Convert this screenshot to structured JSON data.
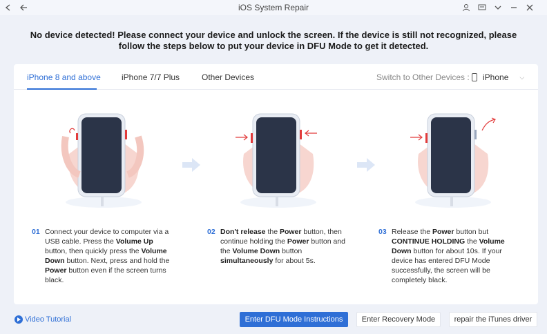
{
  "window": {
    "title": "iOS System Repair"
  },
  "headline": {
    "line1": "No device detected! Please connect your device and unlock the screen. If the device is still not recognized, please",
    "line2": "follow the steps below to put your device in DFU Mode to get it detected."
  },
  "tabs": [
    {
      "label": "iPhone 8 and above",
      "active": true
    },
    {
      "label": "iPhone 7/7 Plus",
      "active": false
    },
    {
      "label": "Other Devices",
      "active": false
    }
  ],
  "device_switch": {
    "label": "Switch to Other Devices :",
    "value": "iPhone"
  },
  "steps": [
    {
      "num": "01",
      "parts": [
        "Connect your device to computer via a USB cable. Press the ",
        "Volume Up",
        " button, then quickly press the ",
        "Volume Down",
        " button. Next, press and hold the ",
        "Power",
        " button even if the screen turns black."
      ]
    },
    {
      "num": "02",
      "parts": [
        "Don't release",
        " the ",
        "Power",
        " button, then continue holding the ",
        "Power",
        " button and the ",
        "Volume Down",
        " button ",
        "simultaneously",
        " for about 5s."
      ]
    },
    {
      "num": "03",
      "parts": [
        "Release the ",
        "Power",
        " button but ",
        "CONTINUE HOLDING",
        " the ",
        "Volume Down",
        " button for about 10s. If your device has entered DFU Mode successfully, the screen will be completely black."
      ]
    }
  ],
  "footer": {
    "video_tutorial": "Video Tutorial",
    "enter_dfu": "Enter DFU Mode Instructions",
    "enter_recovery": "Enter Recovery Mode",
    "repair_itunes": "repair the iTunes driver"
  },
  "colors": {
    "accent": "#2f6fd6",
    "background": "#eef1f8",
    "button_red": "#e23b3b"
  },
  "icons": [
    "back-arrow-icon",
    "user-icon",
    "feedback-icon",
    "dropdown-icon",
    "minimize-icon",
    "close-icon",
    "phone-icon",
    "chevron-down-icon",
    "play-icon"
  ]
}
